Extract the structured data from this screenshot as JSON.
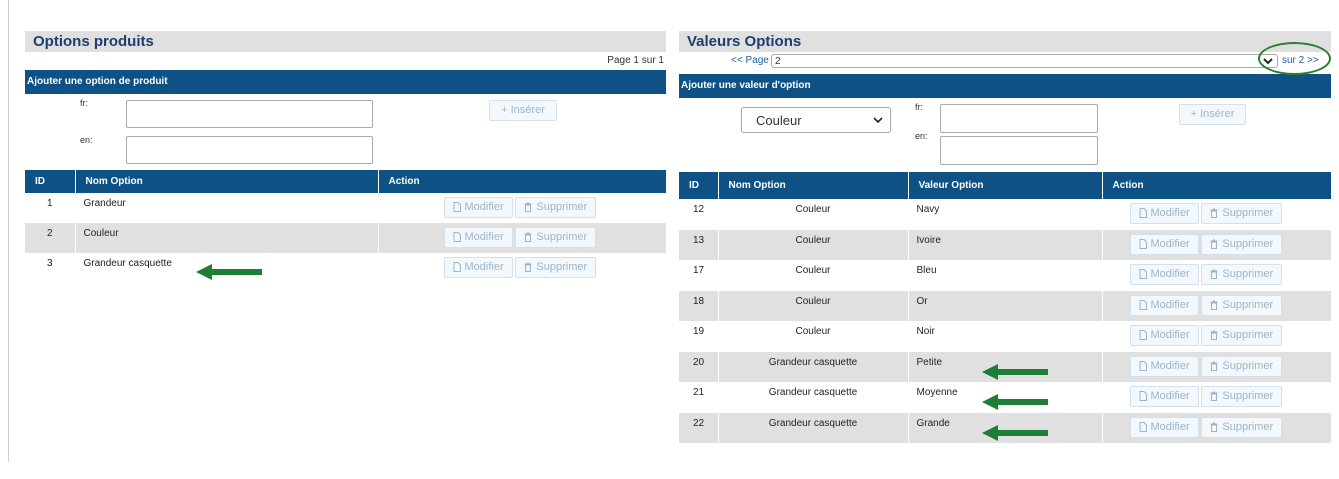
{
  "options_panel": {
    "title": "Options produits",
    "pager_text": "Page 1 sur 1",
    "add_bar": "Ajouter une option de produit",
    "form": {
      "fr_label": "fr:",
      "en_label": "en:",
      "insert_label": "+  Insérer"
    },
    "columns": [
      "ID",
      "Nom Option",
      "Action"
    ],
    "rows": [
      {
        "id": "1",
        "name": "Grandeur"
      },
      {
        "id": "2",
        "name": "Couleur"
      },
      {
        "id": "3",
        "name": "Grandeur casquette"
      }
    ]
  },
  "values_panel": {
    "title": "Valeurs Options",
    "pager": {
      "prev": "<< Page",
      "page": "2",
      "of": "sur 2",
      "next": ">>"
    },
    "add_bar": "Ajouter une valeur d'option",
    "form": {
      "option_select": "Couleur",
      "fr_label": "fr:",
      "en_label": "en:",
      "insert_label": "+  Insérer"
    },
    "columns": [
      "ID",
      "Nom Option",
      "Valeur Option",
      "Action"
    ],
    "rows": [
      {
        "id": "12",
        "option": "Couleur",
        "value": "Navy"
      },
      {
        "id": "13",
        "option": "Couleur",
        "value": "Ivoire"
      },
      {
        "id": "17",
        "option": "Couleur",
        "value": "Bleu"
      },
      {
        "id": "18",
        "option": "Couleur",
        "value": "Or"
      },
      {
        "id": "19",
        "option": "Couleur",
        "value": "Noir"
      },
      {
        "id": "20",
        "option": "Grandeur casquette",
        "value": "Petite"
      },
      {
        "id": "21",
        "option": "Grandeur casquette",
        "value": "Moyenne"
      },
      {
        "id": "22",
        "option": "Grandeur casquette",
        "value": "Grande"
      }
    ]
  },
  "actions": {
    "edit": "Modifier",
    "delete": "Supprimer"
  },
  "icons": {
    "edit": "document-icon",
    "delete": "trash-icon",
    "annotation": "arrow-left-icon",
    "dropdown": "chevron-down-icon"
  },
  "colors": {
    "header_blue": "#0e5185",
    "title_blue": "#1c3f6e",
    "annotation_green": "#1e7e34",
    "row_alt": "#e0e0e0"
  }
}
